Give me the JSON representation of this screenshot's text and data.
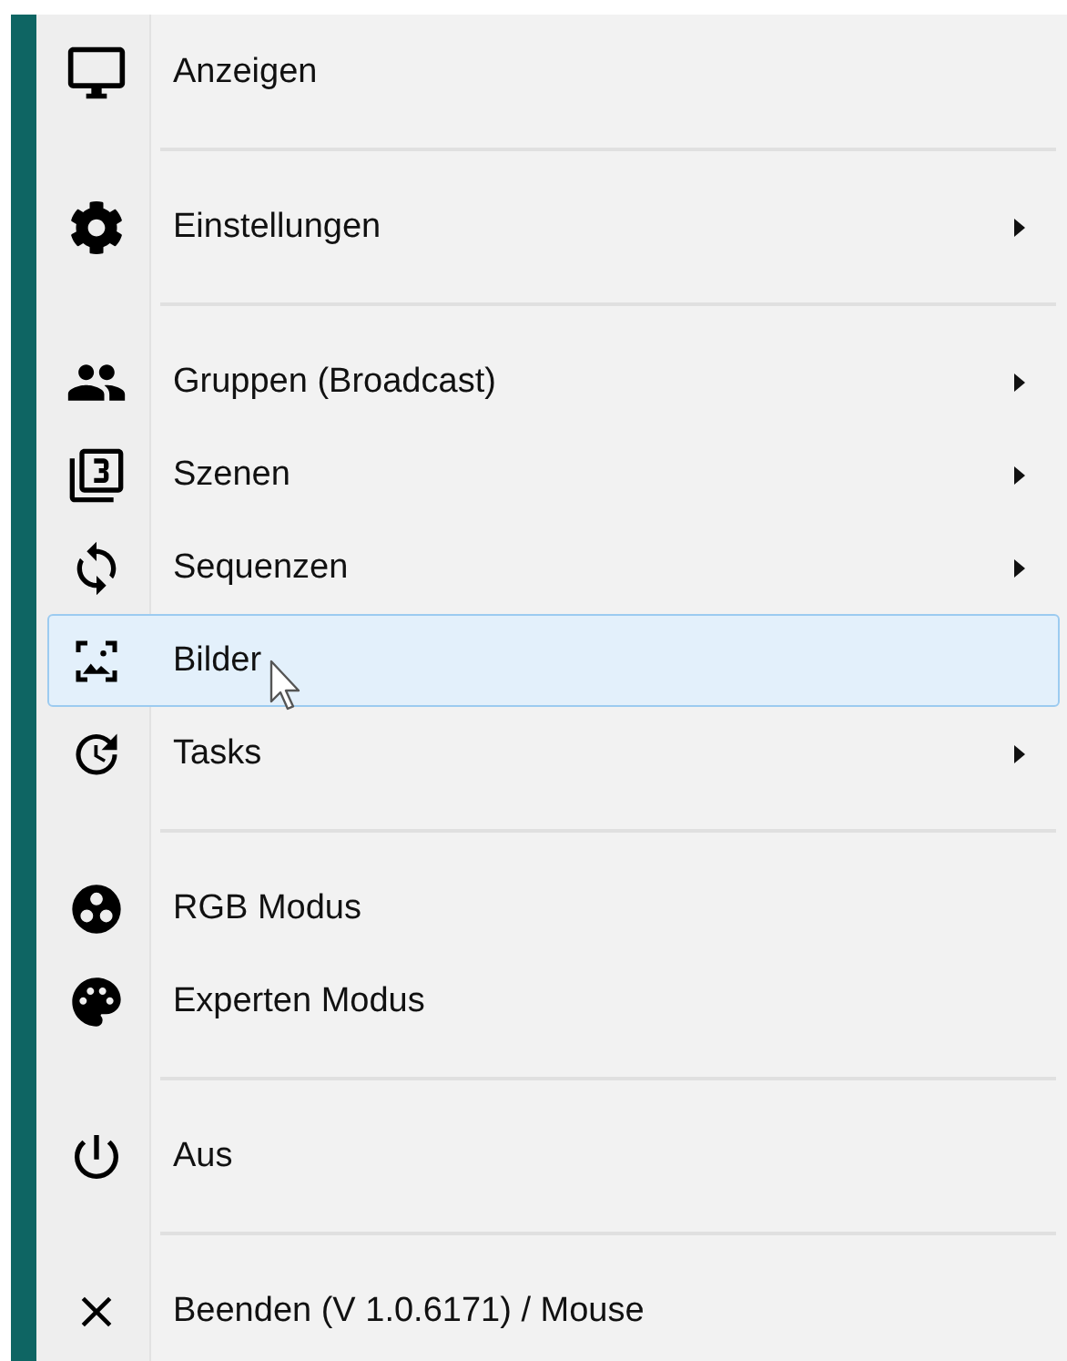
{
  "menu": {
    "items": [
      {
        "kind": "item",
        "label": "Anzeigen",
        "submenu": false,
        "selected": false
      },
      {
        "kind": "separator"
      },
      {
        "kind": "item",
        "label": "Einstellungen",
        "submenu": true,
        "selected": false
      },
      {
        "kind": "separator"
      },
      {
        "kind": "item",
        "label": "Gruppen (Broadcast)",
        "submenu": true,
        "selected": false
      },
      {
        "kind": "item",
        "label": "Szenen",
        "submenu": true,
        "selected": false
      },
      {
        "kind": "item",
        "label": "Sequenzen",
        "submenu": true,
        "selected": false
      },
      {
        "kind": "item",
        "label": "Bilder",
        "submenu": false,
        "selected": true
      },
      {
        "kind": "item",
        "label": "Tasks",
        "submenu": true,
        "selected": false
      },
      {
        "kind": "separator"
      },
      {
        "kind": "item",
        "label": "RGB Modus",
        "submenu": false,
        "selected": false
      },
      {
        "kind": "item",
        "label": "Experten Modus",
        "submenu": false,
        "selected": false
      },
      {
        "kind": "separator"
      },
      {
        "kind": "item",
        "label": "Aus",
        "submenu": false,
        "selected": false
      },
      {
        "kind": "separator"
      },
      {
        "kind": "item",
        "label": "Beenden (V 1.0.6171) / Mouse",
        "submenu": false,
        "selected": false
      }
    ]
  }
}
